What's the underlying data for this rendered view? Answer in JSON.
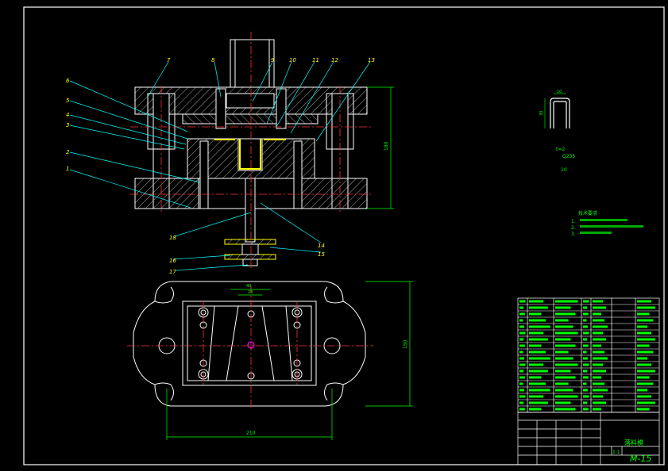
{
  "balloons": [
    "1",
    "2",
    "3",
    "4",
    "5",
    "6",
    "7",
    "8",
    "9",
    "10",
    "11",
    "12",
    "13",
    "14",
    "15",
    "16",
    "17",
    "18"
  ],
  "dimensions": {
    "height_front": "180",
    "height_top": "150",
    "width_bottom": "210",
    "width_top_a": "40",
    "width_top_b": "23",
    "section_top": "30",
    "section_side": "10"
  },
  "part_notes": [
    "t=2",
    "Q235",
    "10"
  ],
  "tech_notes": {
    "title": "技术要求",
    "items": [
      "1.",
      "2.",
      "3."
    ]
  },
  "title_block": {
    "part_name": "落料模",
    "drawing_no": "M-15",
    "scale": "1:1"
  },
  "colors": {
    "background": "#000000",
    "lines": "#ffffff",
    "dimensions": "#00ff00",
    "leaders": "#00ffff",
    "centerlines": "#ff3333",
    "hatch": "#ffffff",
    "highlight": "#ffff00",
    "center_mark": "#ff00ff"
  }
}
